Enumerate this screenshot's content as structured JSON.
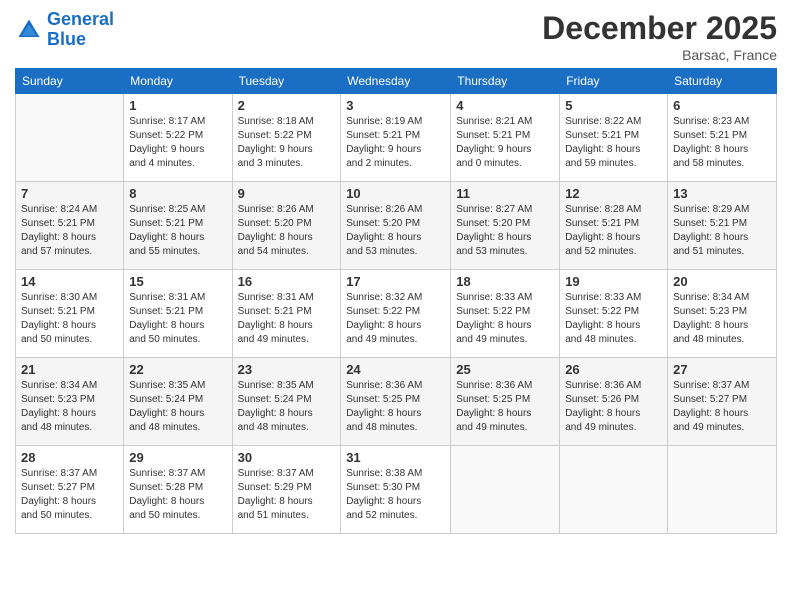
{
  "header": {
    "logo_line1": "General",
    "logo_line2": "Blue",
    "month": "December 2025",
    "location": "Barsac, France"
  },
  "weekdays": [
    "Sunday",
    "Monday",
    "Tuesday",
    "Wednesday",
    "Thursday",
    "Friday",
    "Saturday"
  ],
  "weeks": [
    [
      {
        "day": "",
        "info": ""
      },
      {
        "day": "1",
        "info": "Sunrise: 8:17 AM\nSunset: 5:22 PM\nDaylight: 9 hours\nand 4 minutes."
      },
      {
        "day": "2",
        "info": "Sunrise: 8:18 AM\nSunset: 5:22 PM\nDaylight: 9 hours\nand 3 minutes."
      },
      {
        "day": "3",
        "info": "Sunrise: 8:19 AM\nSunset: 5:21 PM\nDaylight: 9 hours\nand 2 minutes."
      },
      {
        "day": "4",
        "info": "Sunrise: 8:21 AM\nSunset: 5:21 PM\nDaylight: 9 hours\nand 0 minutes."
      },
      {
        "day": "5",
        "info": "Sunrise: 8:22 AM\nSunset: 5:21 PM\nDaylight: 8 hours\nand 59 minutes."
      },
      {
        "day": "6",
        "info": "Sunrise: 8:23 AM\nSunset: 5:21 PM\nDaylight: 8 hours\nand 58 minutes."
      }
    ],
    [
      {
        "day": "7",
        "info": "Sunrise: 8:24 AM\nSunset: 5:21 PM\nDaylight: 8 hours\nand 57 minutes."
      },
      {
        "day": "8",
        "info": "Sunrise: 8:25 AM\nSunset: 5:21 PM\nDaylight: 8 hours\nand 55 minutes."
      },
      {
        "day": "9",
        "info": "Sunrise: 8:26 AM\nSunset: 5:20 PM\nDaylight: 8 hours\nand 54 minutes."
      },
      {
        "day": "10",
        "info": "Sunrise: 8:26 AM\nSunset: 5:20 PM\nDaylight: 8 hours\nand 53 minutes."
      },
      {
        "day": "11",
        "info": "Sunrise: 8:27 AM\nSunset: 5:20 PM\nDaylight: 8 hours\nand 53 minutes."
      },
      {
        "day": "12",
        "info": "Sunrise: 8:28 AM\nSunset: 5:21 PM\nDaylight: 8 hours\nand 52 minutes."
      },
      {
        "day": "13",
        "info": "Sunrise: 8:29 AM\nSunset: 5:21 PM\nDaylight: 8 hours\nand 51 minutes."
      }
    ],
    [
      {
        "day": "14",
        "info": "Sunrise: 8:30 AM\nSunset: 5:21 PM\nDaylight: 8 hours\nand 50 minutes."
      },
      {
        "day": "15",
        "info": "Sunrise: 8:31 AM\nSunset: 5:21 PM\nDaylight: 8 hours\nand 50 minutes."
      },
      {
        "day": "16",
        "info": "Sunrise: 8:31 AM\nSunset: 5:21 PM\nDaylight: 8 hours\nand 49 minutes."
      },
      {
        "day": "17",
        "info": "Sunrise: 8:32 AM\nSunset: 5:22 PM\nDaylight: 8 hours\nand 49 minutes."
      },
      {
        "day": "18",
        "info": "Sunrise: 8:33 AM\nSunset: 5:22 PM\nDaylight: 8 hours\nand 49 minutes."
      },
      {
        "day": "19",
        "info": "Sunrise: 8:33 AM\nSunset: 5:22 PM\nDaylight: 8 hours\nand 48 minutes."
      },
      {
        "day": "20",
        "info": "Sunrise: 8:34 AM\nSunset: 5:23 PM\nDaylight: 8 hours\nand 48 minutes."
      }
    ],
    [
      {
        "day": "21",
        "info": "Sunrise: 8:34 AM\nSunset: 5:23 PM\nDaylight: 8 hours\nand 48 minutes."
      },
      {
        "day": "22",
        "info": "Sunrise: 8:35 AM\nSunset: 5:24 PM\nDaylight: 8 hours\nand 48 minutes."
      },
      {
        "day": "23",
        "info": "Sunrise: 8:35 AM\nSunset: 5:24 PM\nDaylight: 8 hours\nand 48 minutes."
      },
      {
        "day": "24",
        "info": "Sunrise: 8:36 AM\nSunset: 5:25 PM\nDaylight: 8 hours\nand 48 minutes."
      },
      {
        "day": "25",
        "info": "Sunrise: 8:36 AM\nSunset: 5:25 PM\nDaylight: 8 hours\nand 49 minutes."
      },
      {
        "day": "26",
        "info": "Sunrise: 8:36 AM\nSunset: 5:26 PM\nDaylight: 8 hours\nand 49 minutes."
      },
      {
        "day": "27",
        "info": "Sunrise: 8:37 AM\nSunset: 5:27 PM\nDaylight: 8 hours\nand 49 minutes."
      }
    ],
    [
      {
        "day": "28",
        "info": "Sunrise: 8:37 AM\nSunset: 5:27 PM\nDaylight: 8 hours\nand 50 minutes."
      },
      {
        "day": "29",
        "info": "Sunrise: 8:37 AM\nSunset: 5:28 PM\nDaylight: 8 hours\nand 50 minutes."
      },
      {
        "day": "30",
        "info": "Sunrise: 8:37 AM\nSunset: 5:29 PM\nDaylight: 8 hours\nand 51 minutes."
      },
      {
        "day": "31",
        "info": "Sunrise: 8:38 AM\nSunset: 5:30 PM\nDaylight: 8 hours\nand 52 minutes."
      },
      {
        "day": "",
        "info": ""
      },
      {
        "day": "",
        "info": ""
      },
      {
        "day": "",
        "info": ""
      }
    ]
  ]
}
